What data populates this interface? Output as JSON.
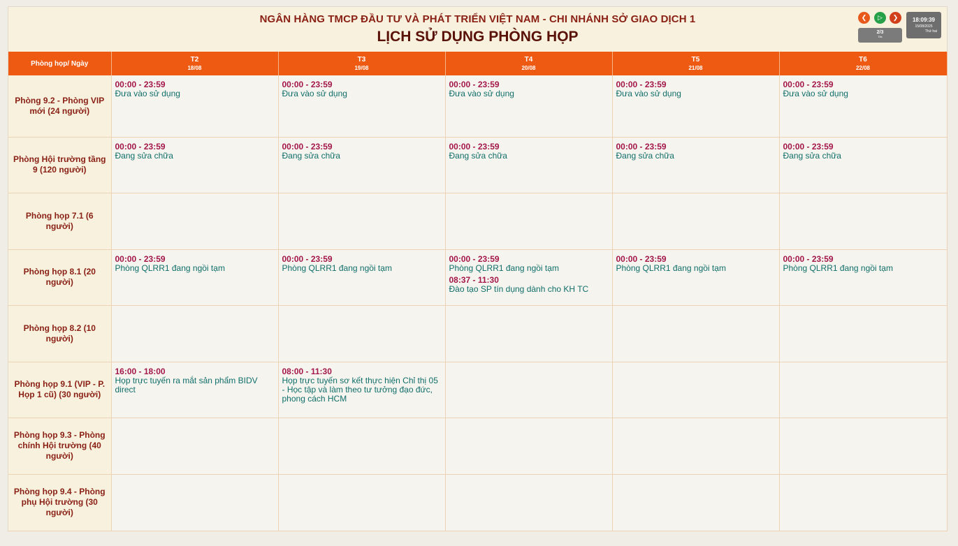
{
  "header": {
    "org_title": "NGÂN HÀNG TMCP ĐẦU TƯ VÀ PHÁT TRIỂN VIỆT NAM - CHI NHÁNH SỞ GIAO DỊCH 1",
    "main_title": "LỊCH SỬ DỤNG PHÒNG HỌP"
  },
  "controls": {
    "prev_icon": "chevron-left-icon",
    "play_icon": "play-icon",
    "next_icon": "chevron-right-icon",
    "page": "2/3",
    "page_label": "Tits"
  },
  "clock": {
    "time": "18:09:39",
    "date": "15/08/2025",
    "day": "Thứ hai"
  },
  "table": {
    "corner": "Phòng họp/ Ngày",
    "days": [
      {
        "name": "T2",
        "date": "18/08"
      },
      {
        "name": "T3",
        "date": "19/08"
      },
      {
        "name": "T4",
        "date": "20/08"
      },
      {
        "name": "T5",
        "date": "21/08"
      },
      {
        "name": "T6",
        "date": "22/08"
      }
    ],
    "rooms": [
      {
        "name": "Phòng 9.2 - Phòng VIP mới (24 người)",
        "days": [
          [
            {
              "time": "00:00 - 23:59",
              "title": "Đưa vào sử dụng"
            }
          ],
          [
            {
              "time": "00:00 - 23:59",
              "title": "Đưa vào sử dụng"
            }
          ],
          [
            {
              "time": "00:00 - 23:59",
              "title": "Đưa vào sử dụng"
            }
          ],
          [
            {
              "time": "00:00 - 23:59",
              "title": "Đưa vào sử dụng"
            }
          ],
          [
            {
              "time": "00:00 - 23:59",
              "title": "Đưa vào sử dụng"
            }
          ]
        ]
      },
      {
        "name": "Phòng Hội trường tầng 9 (120 người)",
        "days": [
          [
            {
              "time": "00:00 - 23:59",
              "title": "Đang sửa chữa"
            }
          ],
          [
            {
              "time": "00:00 - 23:59",
              "title": "Đang sửa chữa"
            }
          ],
          [
            {
              "time": "00:00 - 23:59",
              "title": "Đang sửa chữa"
            }
          ],
          [
            {
              "time": "00:00 - 23:59",
              "title": "Đang sửa chữa"
            }
          ],
          [
            {
              "time": "00:00 - 23:59",
              "title": "Đang sửa chữa"
            }
          ]
        ]
      },
      {
        "name": "Phòng họp 7.1 (6 người)",
        "days": [
          [],
          [],
          [],
          [],
          []
        ]
      },
      {
        "name": "Phòng họp 8.1 (20 người)",
        "days": [
          [
            {
              "time": "00:00 - 23:59",
              "title": "Phòng QLRR1 đang ngồi tạm"
            }
          ],
          [
            {
              "time": "00:00 - 23:59",
              "title": "Phòng QLRR1 đang ngồi tạm"
            }
          ],
          [
            {
              "time": "00:00 - 23:59",
              "title": "Phòng QLRR1 đang ngồi tạm"
            },
            {
              "time": "08:37 - 11:30",
              "title": "Đào tạo SP tín dụng dành cho KH TC"
            }
          ],
          [
            {
              "time": "00:00 - 23:59",
              "title": "Phòng QLRR1 đang ngồi tạm"
            }
          ],
          [
            {
              "time": "00:00 - 23:59",
              "title": "Phòng QLRR1 đang ngồi tạm"
            }
          ]
        ]
      },
      {
        "name": "Phòng họp 8.2 (10 người)",
        "days": [
          [],
          [],
          [],
          [],
          []
        ]
      },
      {
        "name": "Phòng họp 9.1 (VIP - P. Họp 1 cũ) (30 người)",
        "days": [
          [
            {
              "time": "16:00 - 18:00",
              "title": "Họp trực tuyến ra mắt sản phẩm BIDV direct"
            }
          ],
          [
            {
              "time": "08:00 - 11:30",
              "title": "Họp trực tuyến sơ kết thực hiện Chỉ thị 05 - Học tập và làm theo tư tưởng đạo đức, phong cách HCM"
            }
          ],
          [],
          [],
          []
        ]
      },
      {
        "name": "Phòng họp 9.3 - Phòng chính Hội trường (40 người)",
        "days": [
          [],
          [],
          [],
          [],
          []
        ]
      },
      {
        "name": "Phòng họp 9.4 - Phòng phụ Hội trường (30 người)",
        "days": [
          [],
          [],
          [],
          [],
          []
        ]
      }
    ]
  }
}
